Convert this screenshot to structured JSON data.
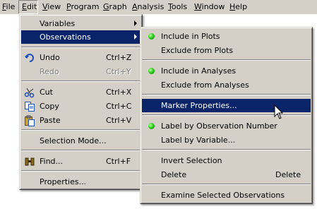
{
  "menubar": {
    "items": [
      {
        "label": "File",
        "mnemonic": "F"
      },
      {
        "label": "Edit",
        "mnemonic": "E"
      },
      {
        "label": "View",
        "mnemonic": "V"
      },
      {
        "label": "Program",
        "mnemonic": "P"
      },
      {
        "label": "Graph",
        "mnemonic": "G"
      },
      {
        "label": "Analysis",
        "mnemonic": "A"
      },
      {
        "label": "Tools",
        "mnemonic": "T"
      },
      {
        "label": "Window",
        "mnemonic": "W"
      },
      {
        "label": "Help",
        "mnemonic": "H"
      }
    ],
    "active": "Edit"
  },
  "edit_menu": {
    "items": [
      {
        "label": "Variables",
        "shortcut": "",
        "submenu": true
      },
      {
        "label": "Observations",
        "shortcut": "",
        "submenu": true,
        "highlighted": true
      },
      {
        "label": "Undo",
        "shortcut": "Ctrl+Z",
        "icon": "undo-icon"
      },
      {
        "label": "Redo",
        "shortcut": "Ctrl+Y",
        "disabled": true
      },
      {
        "label": "Cut",
        "shortcut": "Ctrl+X",
        "icon": "scissors-icon"
      },
      {
        "label": "Copy",
        "shortcut": "Ctrl+C",
        "icon": "copy-icon"
      },
      {
        "label": "Paste",
        "shortcut": "Ctrl+V",
        "icon": "paste-icon"
      },
      {
        "label": "Selection Mode..."
      },
      {
        "label": "Find...",
        "shortcut": "Ctrl+F",
        "icon": "binoculars-icon"
      },
      {
        "label": "Properties..."
      }
    ]
  },
  "observations_menu": {
    "items": [
      {
        "label": "Include in Plots",
        "checked": true
      },
      {
        "label": "Exclude from Plots"
      },
      {
        "label": "Include in Analyses",
        "checked": true
      },
      {
        "label": "Exclude from Analyses"
      },
      {
        "label": "Marker Properties...",
        "highlighted": true
      },
      {
        "label": "Label by Observation Number",
        "checked": true
      },
      {
        "label": "Label by Variable..."
      },
      {
        "label": "Invert Selection"
      },
      {
        "label": "Delete",
        "shortcut": "Delete"
      },
      {
        "label": "Examine Selected Observations"
      }
    ]
  },
  "colors": {
    "menu_bg": "#d4d0c8",
    "highlight": "#0a246a",
    "check_dot": "#2fcf1f"
  }
}
